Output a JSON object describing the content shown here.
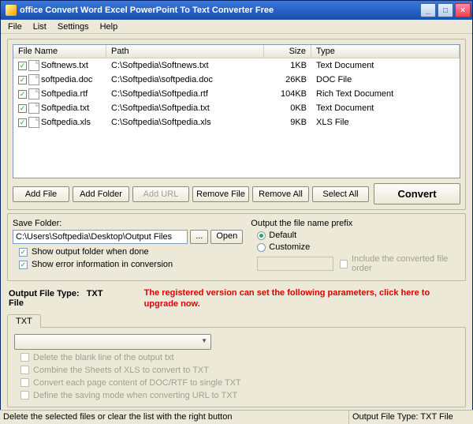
{
  "window": {
    "title": "office Convert Word Excel PowerPoint To Text Converter Free"
  },
  "menu": {
    "file": "File",
    "list": "List",
    "settings": "Settings",
    "help": "Help"
  },
  "columns": {
    "fname": "File Name",
    "path": "Path",
    "size": "Size",
    "type": "Type"
  },
  "files": [
    {
      "name": "Softnews.txt",
      "path": "C:\\Softpedia\\Softnews.txt",
      "size": "1KB",
      "type": "Text Document"
    },
    {
      "name": "softpedia.doc",
      "path": "C:\\Softpedia\\softpedia.doc",
      "size": "26KB",
      "type": "DOC File"
    },
    {
      "name": "Softpedia.rtf",
      "path": "C:\\Softpedia\\Softpedia.rtf",
      "size": "104KB",
      "type": "Rich Text Document"
    },
    {
      "name": "Softpedia.txt",
      "path": "C:\\Softpedia\\Softpedia.txt",
      "size": "0KB",
      "type": "Text Document"
    },
    {
      "name": "Softpedia.xls",
      "path": "C:\\Softpedia\\Softpedia.xls",
      "size": "9KB",
      "type": "XLS File"
    }
  ],
  "buttons": {
    "addfile": "Add File",
    "addfolder": "Add Folder",
    "addurl": "Add URL",
    "removefile": "Remove File",
    "removeall": "Remove All",
    "selectall": "Select All",
    "convert": "Convert",
    "browse": "...",
    "open": "Open"
  },
  "save": {
    "label": "Save Folder:",
    "path": "C:\\Users\\Softpedia\\Desktop\\Output Files",
    "showfolder": "Show output folder when done",
    "showerror": "Show error information in conversion"
  },
  "prefix": {
    "label": "Output the file name prefix",
    "default": "Default",
    "customize": "Customize",
    "include": "Include the converted file order"
  },
  "outtype": {
    "label": "Output File Type:",
    "value": "TXT File"
  },
  "upgrade": "The registered version can set the following parameters, click here to upgrade now.",
  "tab": {
    "txt": "TXT"
  },
  "options": {
    "deleteblank": "Delete the blank line of the output txt",
    "combinesheets": "Combine the Sheets of XLS to convert to TXT",
    "convertpage": "Convert each page content of DOC/RTF to single TXT",
    "definesave": "Define the saving mode when converting URL to TXT"
  },
  "status": {
    "hint": "Delete the selected files or clear the list with the right button",
    "outtype": "Output File Type:  TXT File"
  }
}
